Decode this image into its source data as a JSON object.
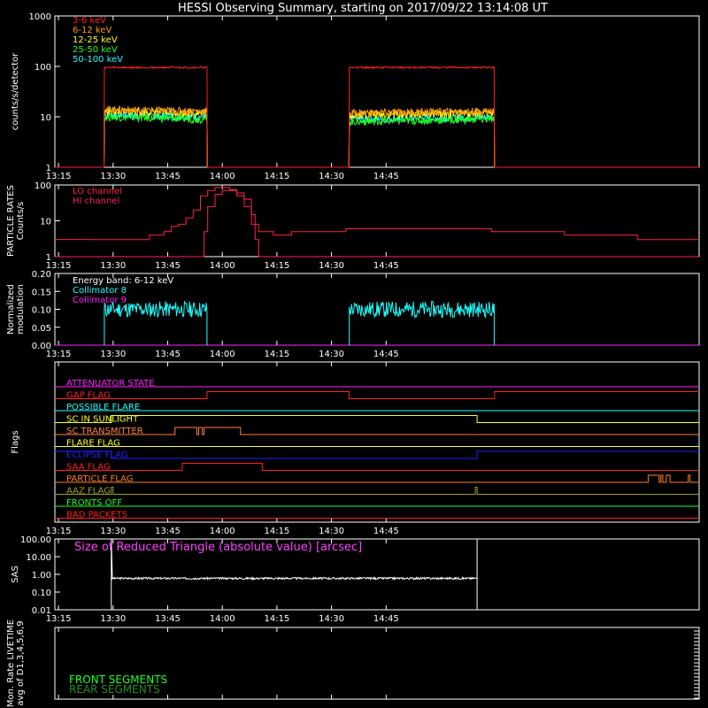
{
  "title": "HESSI Observing Summary, starting on 2017/09/22 13:14:08 UT",
  "time_ticks": [
    "13:15",
    "13:30",
    "13:45",
    "14:00",
    "14:15",
    "14:30",
    "14:45"
  ],
  "chart_data": [
    {
      "type": "line",
      "ylabel": "counts/s/detector",
      "scale": "log",
      "ylim": [
        1,
        1000
      ],
      "yticks": [
        "1",
        "10",
        "100",
        "1000"
      ],
      "legend": [
        {
          "name": "3-6 keV",
          "color": "#ff2020"
        },
        {
          "name": "6-12 keV",
          "color": "#ff9a00"
        },
        {
          "name": "12-25 keV",
          "color": "#ffff20"
        },
        {
          "name": "25-50 keV",
          "color": "#20ff20"
        },
        {
          "name": "50-100 keV",
          "color": "#20ffff"
        }
      ],
      "x_minutes": [
        0,
        13.5,
        13.6,
        41.8,
        41.9,
        80.8,
        80.9,
        120.7,
        120.8,
        177
      ],
      "series": [
        {
          "name": "3-6 keV",
          "color": "#ff2020",
          "values": [
            1,
            1,
            95,
            95,
            1,
            1,
            95,
            95,
            1,
            1
          ]
        },
        {
          "name": "6-12 keV",
          "color": "#ff9a00",
          "values": [
            1,
            1,
            14,
            13,
            1,
            1,
            12,
            13,
            1,
            1
          ]
        },
        {
          "name": "12-25 keV",
          "color": "#ffff20",
          "values": [
            1,
            1,
            13,
            12,
            1,
            1,
            11,
            12,
            1,
            1
          ]
        },
        {
          "name": "25-50 keV",
          "color": "#20ff20",
          "values": [
            1,
            1,
            10,
            9,
            1,
            1,
            8,
            9,
            1,
            1
          ]
        },
        {
          "name": "50-100 keV",
          "color": "#20ffff",
          "values": [
            1,
            1,
            11,
            10,
            1,
            1,
            9,
            10,
            1,
            1
          ]
        }
      ]
    },
    {
      "type": "line",
      "ylabel_lines": [
        "PARTICLE RATES",
        "Counts/s"
      ],
      "scale": "log",
      "ylim": [
        1,
        100
      ],
      "yticks": [
        "1",
        "10",
        "100"
      ],
      "legend": [
        {
          "name": "LO channel",
          "color": "#ff2040"
        },
        {
          "name": "HI channel",
          "color": "#ff2060"
        }
      ],
      "x_minutes": [
        0,
        10,
        20,
        26,
        30,
        32,
        34,
        36,
        38,
        40,
        42,
        44,
        46,
        48,
        50,
        52,
        54,
        56,
        60,
        65,
        70,
        80,
        100,
        120,
        140,
        160,
        177
      ],
      "series": [
        {
          "name": "LO channel",
          "color": "#ff2040",
          "values": [
            3,
            3,
            3,
            4,
            5,
            7,
            8,
            12,
            20,
            50,
            70,
            85,
            85,
            75,
            50,
            25,
            8,
            5,
            4,
            5,
            5,
            6,
            6,
            5,
            4,
            3,
            3
          ]
        },
        {
          "name": "HI channel",
          "color": "#ff2060",
          "x_minutes": [
            0,
            40,
            41,
            42,
            44,
            46,
            48,
            50,
            52,
            54,
            55,
            56,
            177
          ],
          "values": [
            1,
            1,
            5,
            25,
            55,
            70,
            70,
            60,
            40,
            15,
            3,
            1,
            1
          ]
        }
      ]
    },
    {
      "type": "line",
      "ylabel_lines": [
        "Normalized",
        "modulation"
      ],
      "ylim": [
        0,
        0.2
      ],
      "yticks": [
        "0.00",
        "0.05",
        "0.10",
        "0.15",
        "0.20"
      ],
      "legend": [
        {
          "name": "Energy band: 6-12 keV",
          "color": "#ffffff"
        },
        {
          "name": "Collimator 8",
          "color": "#20ffff"
        },
        {
          "name": "Collimator 9",
          "color": "#ff20ff"
        }
      ],
      "segments": [
        [
          13.6,
          41.8,
          0.1
        ],
        [
          80.9,
          120.7,
          0.1
        ]
      ]
    },
    {
      "type": "step",
      "ylabel": "Flags",
      "flags": [
        {
          "name": "ATTENUATOR STATE",
          "color": "#ff20ff",
          "changes": []
        },
        {
          "name": "GAP FLAG",
          "color": "#ff2020",
          "changes": [
            [
              0,
              0
            ],
            [
              41.8,
              1
            ],
            [
              80.8,
              0
            ],
            [
              120.8,
              1
            ]
          ]
        },
        {
          "name": "POSSIBLE FLARE",
          "color": "#20ffff",
          "changes": []
        },
        {
          "name": "SC IN SUNLIGHT",
          "color": "#ffff20",
          "changes": [
            [
              0,
              0
            ],
            [
              15.5,
              1
            ],
            [
              116,
              0
            ]
          ]
        },
        {
          "name": "SC TRANSMITTER",
          "color": "#ff8040",
          "changes": [
            [
              0,
              0
            ],
            [
              33,
              1
            ],
            [
              39,
              0
            ],
            [
              39.5,
              1
            ],
            [
              40.5,
              0
            ],
            [
              41,
              1
            ],
            [
              51,
              0
            ]
          ]
        },
        {
          "name": "FLARE FLAG",
          "color": "#ffff20",
          "changes": []
        },
        {
          "name": "ECLIPSE FLAG",
          "color": "#2020ff",
          "changes": [
            [
              0,
              1
            ],
            [
              15.5,
              0
            ],
            [
              116,
              1
            ]
          ]
        },
        {
          "name": "SAA FLAG",
          "color": "#ff2020",
          "changes": [
            [
              0,
              0
            ],
            [
              35,
              1
            ],
            [
              57,
              0
            ]
          ]
        },
        {
          "name": "PARTICLE FLAG",
          "color": "#ff8020",
          "changes": [
            [
              0,
              0
            ],
            [
              163,
              1
            ],
            [
              166,
              0
            ],
            [
              166.5,
              1
            ],
            [
              167,
              0
            ],
            [
              168,
              1
            ],
            [
              169,
              0
            ],
            [
              174,
              1
            ],
            [
              174.5,
              0
            ]
          ]
        },
        {
          "name": "AAZ FLAG",
          "color": "#a0a020",
          "changes": [
            [
              0,
              0
            ],
            [
              15.5,
              1
            ],
            [
              16,
              0
            ],
            [
              115.5,
              1
            ],
            [
              116,
              0
            ]
          ]
        },
        {
          "name": "FRONTS OFF",
          "color": "#20ff20",
          "changes": []
        },
        {
          "name": "BAD PACKETS",
          "color": "#ff2020",
          "changes": []
        }
      ]
    },
    {
      "type": "line",
      "ylabel": "SAS",
      "scale": "log",
      "ylim": [
        0.01,
        100
      ],
      "yticks": [
        "0.01",
        "0.10",
        "1.00",
        "10.00",
        "100.00"
      ],
      "annotation": "Size of Reduced Triangle (absolute value) [arcsec]",
      "segment": [
        15.5,
        116,
        0.6
      ]
    },
    {
      "type": "line",
      "ylabel_lines": [
        "Mon. Rate LIVETIME",
        "avg of D1,3,4,5,6,9"
      ],
      "legend": [
        {
          "name": "FRONT SEGMENTS",
          "color": "#20ff20"
        },
        {
          "name": "REAR SEGMENTS",
          "color": "#209020"
        }
      ]
    }
  ]
}
